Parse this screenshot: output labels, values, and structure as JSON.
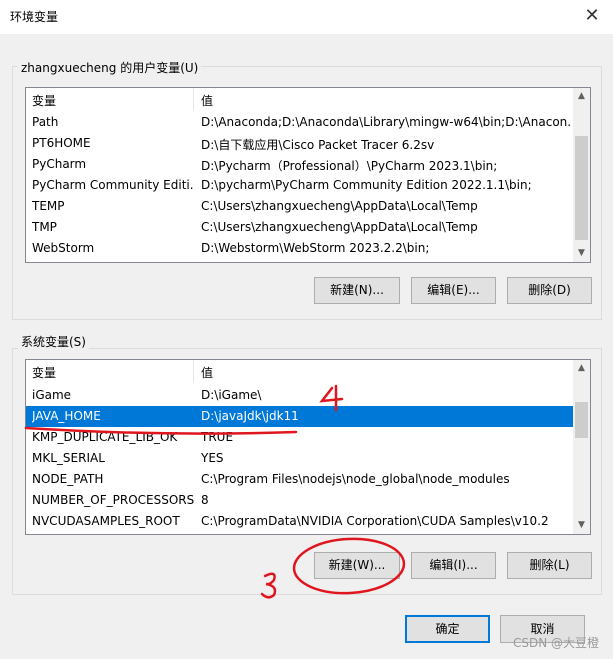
{
  "window": {
    "title": "环境变量",
    "close_icon": "close-icon"
  },
  "user_vars": {
    "group_label": "zhangxuecheng 的用户变量(U)",
    "headers": {
      "name": "变量",
      "value": "值"
    },
    "rows": [
      {
        "name": "Path",
        "value": "D:\\Anaconda;D:\\Anaconda\\Library\\mingw-w64\\bin;D:\\Anacon..."
      },
      {
        "name": "PT6HOME",
        "value": "D:\\自下载应用\\Cisco Packet Tracer 6.2sv"
      },
      {
        "name": "PyCharm",
        "value": "D:\\Pycharm（Professional）\\PyCharm 2023.1\\bin;"
      },
      {
        "name": "PyCharm Community Editi...",
        "value": "D:\\pycharm\\PyCharm Community Edition 2022.1.1\\bin;"
      },
      {
        "name": "TEMP",
        "value": "C:\\Users\\zhangxuecheng\\AppData\\Local\\Temp"
      },
      {
        "name": "TMP",
        "value": "C:\\Users\\zhangxuecheng\\AppData\\Local\\Temp"
      },
      {
        "name": "WebStorm",
        "value": "D:\\Webstorm\\WebStorm 2023.2.2\\bin;"
      }
    ],
    "buttons": {
      "new": "新建(N)...",
      "edit": "编辑(E)...",
      "delete": "删除(D)"
    }
  },
  "system_vars": {
    "group_label": "系统变量(S)",
    "headers": {
      "name": "变量",
      "value": "值"
    },
    "rows": [
      {
        "name": "iGame",
        "value": "D:\\iGame\\"
      },
      {
        "name": "JAVA_HOME",
        "value": "D:\\javaJdk\\jdk11",
        "selected": true
      },
      {
        "name": "KMP_DUPLICATE_LIB_OK",
        "value": "TRUE"
      },
      {
        "name": "MKL_SERIAL",
        "value": "YES"
      },
      {
        "name": "NODE_PATH",
        "value": "C:\\Program Files\\nodejs\\node_global\\node_modules"
      },
      {
        "name": "NUMBER_OF_PROCESSORS",
        "value": "8"
      },
      {
        "name": "NVCUDASAMPLES_ROOT",
        "value": "C:\\ProgramData\\NVIDIA Corporation\\CUDA Samples\\v10.2"
      }
    ],
    "buttons": {
      "new": "新建(W)...",
      "edit": "编辑(I)...",
      "delete": "删除(L)"
    }
  },
  "dialog_buttons": {
    "ok": "确定",
    "cancel": "取消"
  },
  "annotations": {
    "step_3": "3",
    "step_4": "4",
    "color": "#e0161e"
  },
  "watermark": "CSDN @大豆橙",
  "colors": {
    "selection": "#0078d7",
    "accent_border": "#0078d7"
  }
}
